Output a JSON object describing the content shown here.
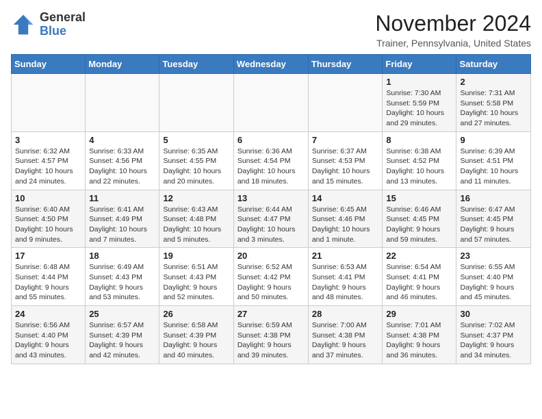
{
  "header": {
    "logo_line1": "General",
    "logo_line2": "Blue",
    "month_year": "November 2024",
    "location": "Trainer, Pennsylvania, United States"
  },
  "days_of_week": [
    "Sunday",
    "Monday",
    "Tuesday",
    "Wednesday",
    "Thursday",
    "Friday",
    "Saturday"
  ],
  "weeks": [
    [
      {
        "day": "",
        "info": ""
      },
      {
        "day": "",
        "info": ""
      },
      {
        "day": "",
        "info": ""
      },
      {
        "day": "",
        "info": ""
      },
      {
        "day": "",
        "info": ""
      },
      {
        "day": "1",
        "info": "Sunrise: 7:30 AM\nSunset: 5:59 PM\nDaylight: 10 hours\nand 29 minutes."
      },
      {
        "day": "2",
        "info": "Sunrise: 7:31 AM\nSunset: 5:58 PM\nDaylight: 10 hours\nand 27 minutes."
      }
    ],
    [
      {
        "day": "3",
        "info": "Sunrise: 6:32 AM\nSunset: 4:57 PM\nDaylight: 10 hours\nand 24 minutes."
      },
      {
        "day": "4",
        "info": "Sunrise: 6:33 AM\nSunset: 4:56 PM\nDaylight: 10 hours\nand 22 minutes."
      },
      {
        "day": "5",
        "info": "Sunrise: 6:35 AM\nSunset: 4:55 PM\nDaylight: 10 hours\nand 20 minutes."
      },
      {
        "day": "6",
        "info": "Sunrise: 6:36 AM\nSunset: 4:54 PM\nDaylight: 10 hours\nand 18 minutes."
      },
      {
        "day": "7",
        "info": "Sunrise: 6:37 AM\nSunset: 4:53 PM\nDaylight: 10 hours\nand 15 minutes."
      },
      {
        "day": "8",
        "info": "Sunrise: 6:38 AM\nSunset: 4:52 PM\nDaylight: 10 hours\nand 13 minutes."
      },
      {
        "day": "9",
        "info": "Sunrise: 6:39 AM\nSunset: 4:51 PM\nDaylight: 10 hours\nand 11 minutes."
      }
    ],
    [
      {
        "day": "10",
        "info": "Sunrise: 6:40 AM\nSunset: 4:50 PM\nDaylight: 10 hours\nand 9 minutes."
      },
      {
        "day": "11",
        "info": "Sunrise: 6:41 AM\nSunset: 4:49 PM\nDaylight: 10 hours\nand 7 minutes."
      },
      {
        "day": "12",
        "info": "Sunrise: 6:43 AM\nSunset: 4:48 PM\nDaylight: 10 hours\nand 5 minutes."
      },
      {
        "day": "13",
        "info": "Sunrise: 6:44 AM\nSunset: 4:47 PM\nDaylight: 10 hours\nand 3 minutes."
      },
      {
        "day": "14",
        "info": "Sunrise: 6:45 AM\nSunset: 4:46 PM\nDaylight: 10 hours\nand 1 minute."
      },
      {
        "day": "15",
        "info": "Sunrise: 6:46 AM\nSunset: 4:45 PM\nDaylight: 9 hours\nand 59 minutes."
      },
      {
        "day": "16",
        "info": "Sunrise: 6:47 AM\nSunset: 4:45 PM\nDaylight: 9 hours\nand 57 minutes."
      }
    ],
    [
      {
        "day": "17",
        "info": "Sunrise: 6:48 AM\nSunset: 4:44 PM\nDaylight: 9 hours\nand 55 minutes."
      },
      {
        "day": "18",
        "info": "Sunrise: 6:49 AM\nSunset: 4:43 PM\nDaylight: 9 hours\nand 53 minutes."
      },
      {
        "day": "19",
        "info": "Sunrise: 6:51 AM\nSunset: 4:43 PM\nDaylight: 9 hours\nand 52 minutes."
      },
      {
        "day": "20",
        "info": "Sunrise: 6:52 AM\nSunset: 4:42 PM\nDaylight: 9 hours\nand 50 minutes."
      },
      {
        "day": "21",
        "info": "Sunrise: 6:53 AM\nSunset: 4:41 PM\nDaylight: 9 hours\nand 48 minutes."
      },
      {
        "day": "22",
        "info": "Sunrise: 6:54 AM\nSunset: 4:41 PM\nDaylight: 9 hours\nand 46 minutes."
      },
      {
        "day": "23",
        "info": "Sunrise: 6:55 AM\nSunset: 4:40 PM\nDaylight: 9 hours\nand 45 minutes."
      }
    ],
    [
      {
        "day": "24",
        "info": "Sunrise: 6:56 AM\nSunset: 4:40 PM\nDaylight: 9 hours\nand 43 minutes."
      },
      {
        "day": "25",
        "info": "Sunrise: 6:57 AM\nSunset: 4:39 PM\nDaylight: 9 hours\nand 42 minutes."
      },
      {
        "day": "26",
        "info": "Sunrise: 6:58 AM\nSunset: 4:39 PM\nDaylight: 9 hours\nand 40 minutes."
      },
      {
        "day": "27",
        "info": "Sunrise: 6:59 AM\nSunset: 4:38 PM\nDaylight: 9 hours\nand 39 minutes."
      },
      {
        "day": "28",
        "info": "Sunrise: 7:00 AM\nSunset: 4:38 PM\nDaylight: 9 hours\nand 37 minutes."
      },
      {
        "day": "29",
        "info": "Sunrise: 7:01 AM\nSunset: 4:38 PM\nDaylight: 9 hours\nand 36 minutes."
      },
      {
        "day": "30",
        "info": "Sunrise: 7:02 AM\nSunset: 4:37 PM\nDaylight: 9 hours\nand 34 minutes."
      }
    ]
  ]
}
